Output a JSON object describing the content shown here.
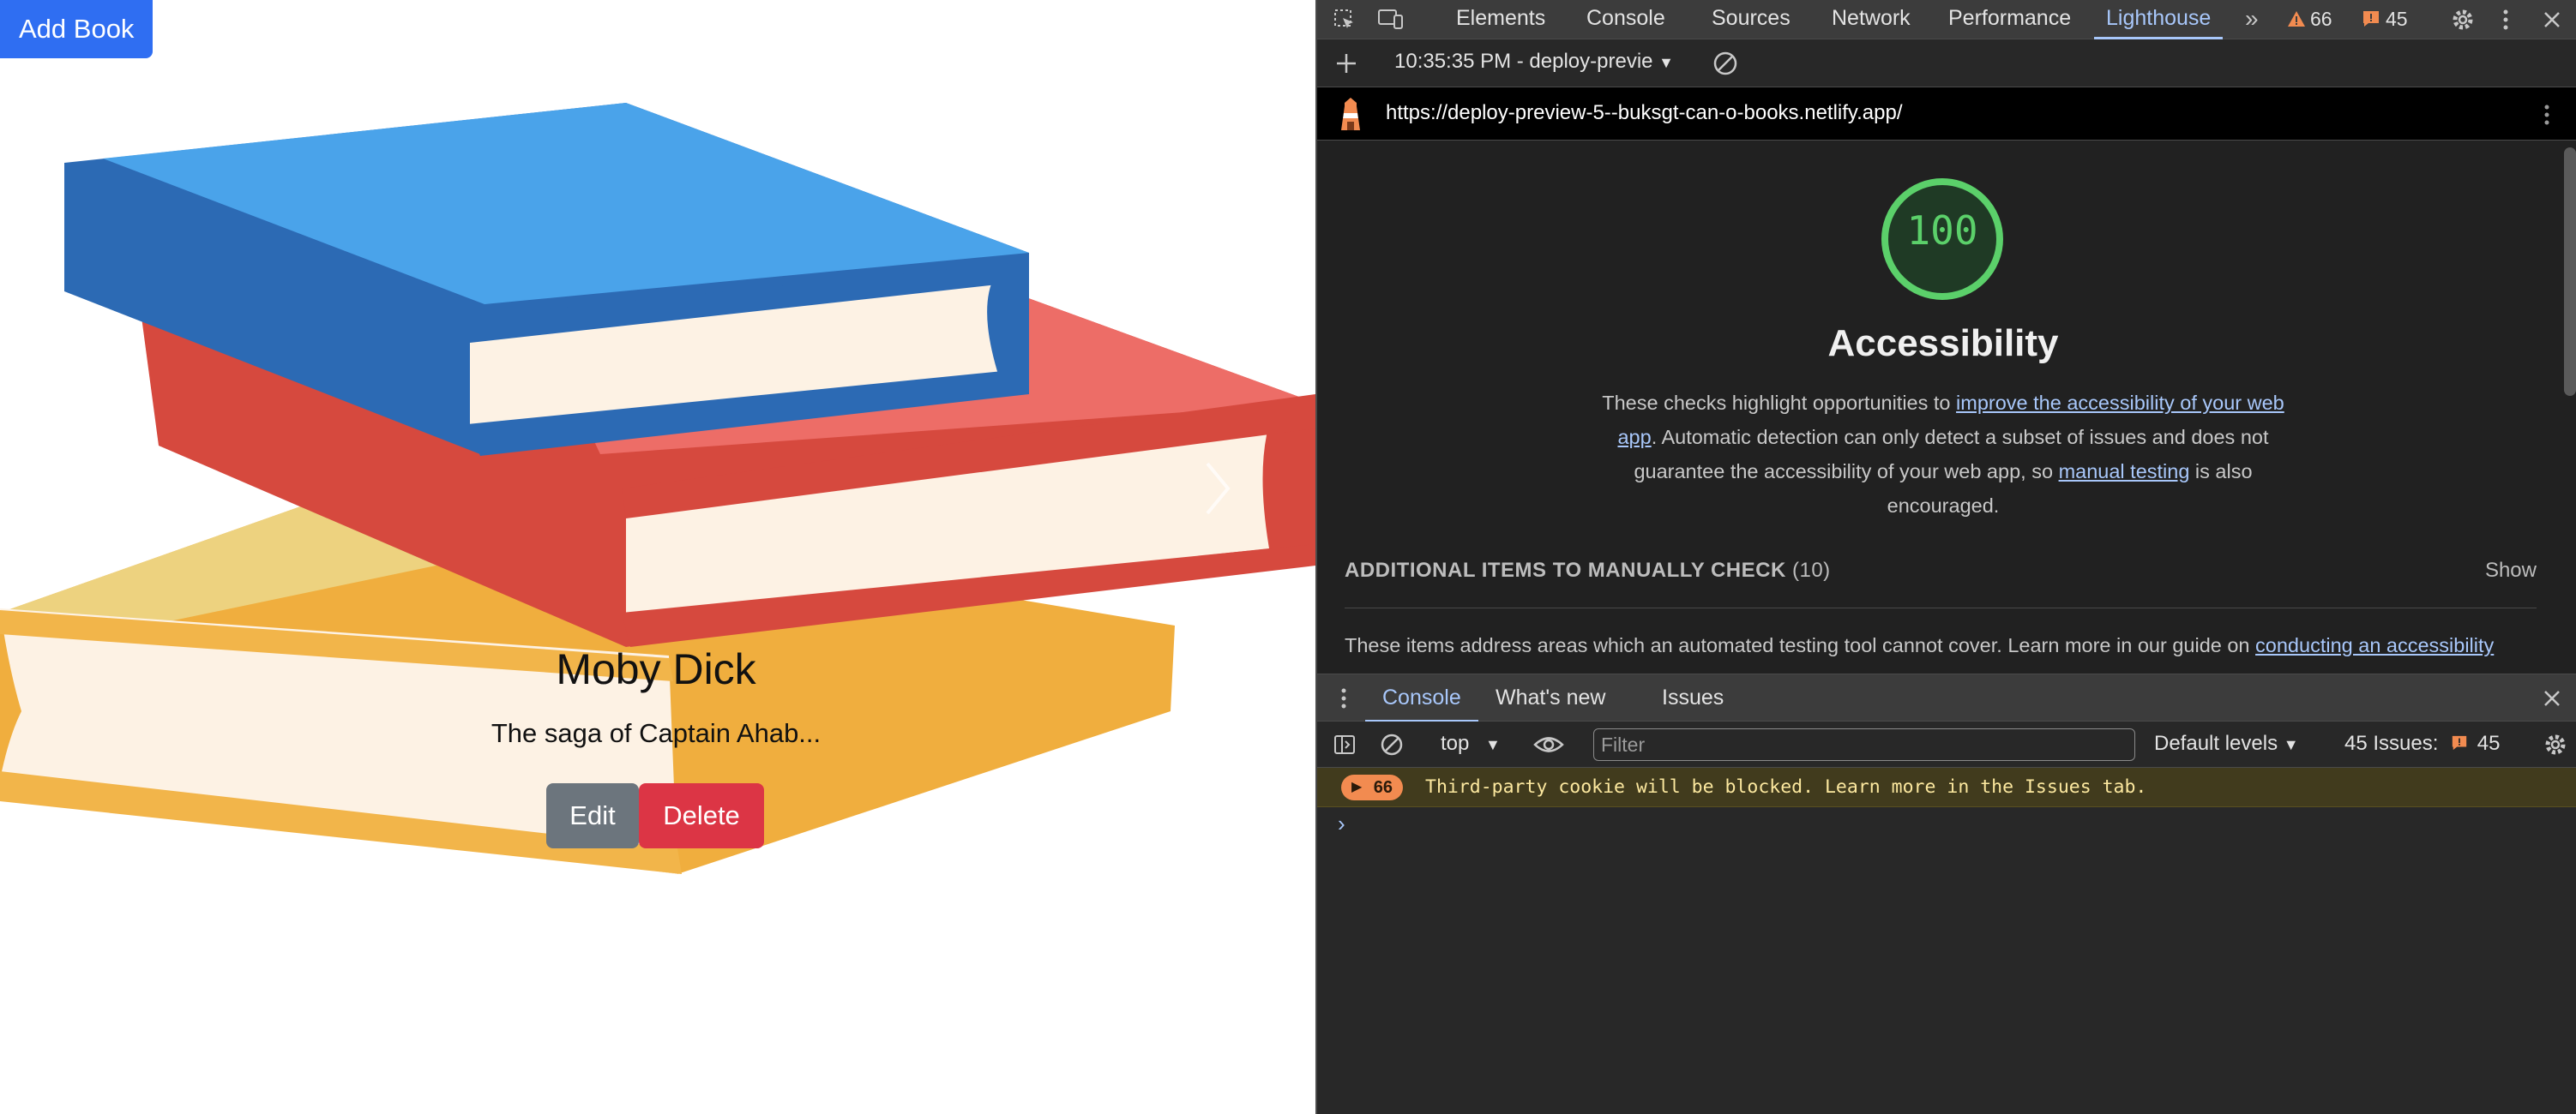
{
  "app": {
    "add_book_label": "Add Book",
    "book": {
      "title": "Moby Dick",
      "description": "The saga of Captain Ahab..."
    },
    "edit_label": "Edit",
    "delete_label": "Delete"
  },
  "devtools": {
    "tabs": [
      "Elements",
      "Console",
      "Sources",
      "Network",
      "Performance",
      "Lighthouse"
    ],
    "active_tab": "Lighthouse",
    "warnings_count": "66",
    "errors_count": "45",
    "report_select": "10:35:35 PM - deploy-previe",
    "url": "https://deploy-preview-5--buksgt-can-o-books.netlify.app/",
    "lighthouse": {
      "score": "100",
      "category_title": "Accessibility",
      "desc_part1": "These checks highlight opportunities to ",
      "desc_link1": "improve the accessibility of your web app",
      "desc_part2": ". Automatic detection can only detect a subset of issues and does not guarantee the accessibility of your web app, so ",
      "desc_link2": "manual testing",
      "desc_part3": " is also encouraged.",
      "manual_heading": "ADDITIONAL ITEMS TO MANUALLY CHECK",
      "manual_count": "(10)",
      "show_label": "Show",
      "manual_desc": "These items address areas which an automated testing tool cannot cover. Learn more in our guide on ",
      "manual_desc_link": "conducting an accessibility"
    },
    "drawer_tabs": [
      "Console",
      "What's new",
      "Issues"
    ],
    "console": {
      "context": "top",
      "filter_placeholder": "Filter",
      "levels": "Default levels",
      "issues_label": "45 Issues:",
      "issues_count": "45",
      "warning_count": "66",
      "warning_text": "Third-party cookie will be blocked. Learn more in the Issues tab.",
      "prompt": "›"
    },
    "colors": {
      "score_green": "#5bd06a",
      "link_blue": "#a8c7fa",
      "warning_bg": "#413b1d",
      "warning_text": "#fce89f"
    }
  }
}
